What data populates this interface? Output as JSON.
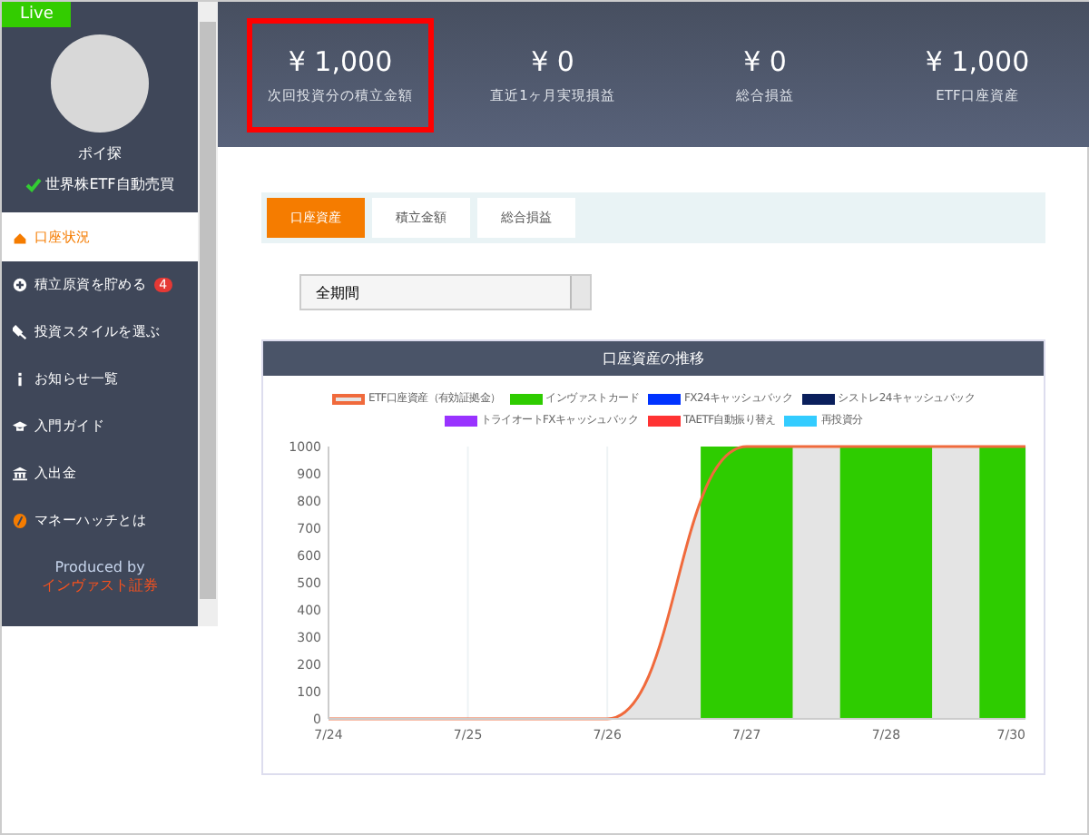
{
  "sidebar": {
    "badge": "Live",
    "profile": {
      "name": "ポイ探",
      "plan": "世界株ETF自動売買"
    },
    "items": [
      {
        "label": "口座状況",
        "selected": true
      },
      {
        "label": "積立原資を貯める",
        "selected": false,
        "badge": "4"
      },
      {
        "label": "投資スタイルを選ぶ",
        "selected": false
      },
      {
        "label": "お知らせ一覧",
        "selected": false
      },
      {
        "label": "入門ガイド",
        "selected": false
      },
      {
        "label": "入出金",
        "selected": false
      },
      {
        "label": "マネーハッチとは",
        "selected": false
      }
    ],
    "footer": {
      "caption": "Produced by",
      "company": "インヴァスト証券"
    }
  },
  "stats": [
    {
      "value": "¥ 1,000",
      "label": "次回投資分の積立金額",
      "highlighted": true
    },
    {
      "value": "¥ 0",
      "label": "直近1ヶ月実現損益",
      "highlighted": false
    },
    {
      "value": "¥ 0",
      "label": "総合損益",
      "highlighted": false
    },
    {
      "value": "¥ 1,000",
      "label": "ETF口座資産",
      "highlighted": false
    }
  ],
  "tabs": [
    {
      "label": "口座資産",
      "selected": true
    },
    {
      "label": "積立金額",
      "selected": false
    },
    {
      "label": "総合損益",
      "selected": false
    }
  ],
  "period_select": {
    "value": "全期間"
  },
  "chart_panel": {
    "title": "口座資産の推移",
    "chart_data": {
      "type": "line",
      "categories": [
        "7/24",
        "7/25",
        "7/26",
        "7/27",
        "7/28",
        "7/30"
      ],
      "ylim": [
        0,
        1000
      ],
      "yticks": [
        0,
        100,
        200,
        300,
        400,
        500,
        600,
        700,
        800,
        900,
        1000
      ],
      "series": [
        {
          "name": "ETF口座資産（有効証拠金）",
          "color": "#f06a3c",
          "values": [
            0,
            0,
            0,
            1000,
            1000,
            1000
          ]
        },
        {
          "name": "インヴァストカード",
          "color": "#2ecc00",
          "type": "bar",
          "values": [
            null,
            null,
            null,
            1000,
            1000,
            1000
          ]
        },
        {
          "name": "FX24キャッシュバック",
          "color": "#0033ff",
          "type": "bar",
          "values": [
            null,
            null,
            null,
            null,
            null,
            null
          ]
        },
        {
          "name": "シストレ24キャッシュバック",
          "color": "#0a1f5c",
          "type": "bar",
          "values": [
            null,
            null,
            null,
            null,
            null,
            null
          ]
        },
        {
          "name": "トライオートFXキャッシュバック",
          "color": "#9933ff",
          "type": "bar",
          "values": [
            null,
            null,
            null,
            null,
            null,
            null
          ]
        },
        {
          "name": "TAETF自動振り替え",
          "color": "#ff3333",
          "type": "bar",
          "values": [
            null,
            null,
            null,
            null,
            null,
            null
          ]
        },
        {
          "name": "再投資分",
          "color": "#33ccff",
          "type": "bar",
          "values": [
            null,
            null,
            null,
            null,
            null,
            null
          ]
        }
      ]
    }
  }
}
